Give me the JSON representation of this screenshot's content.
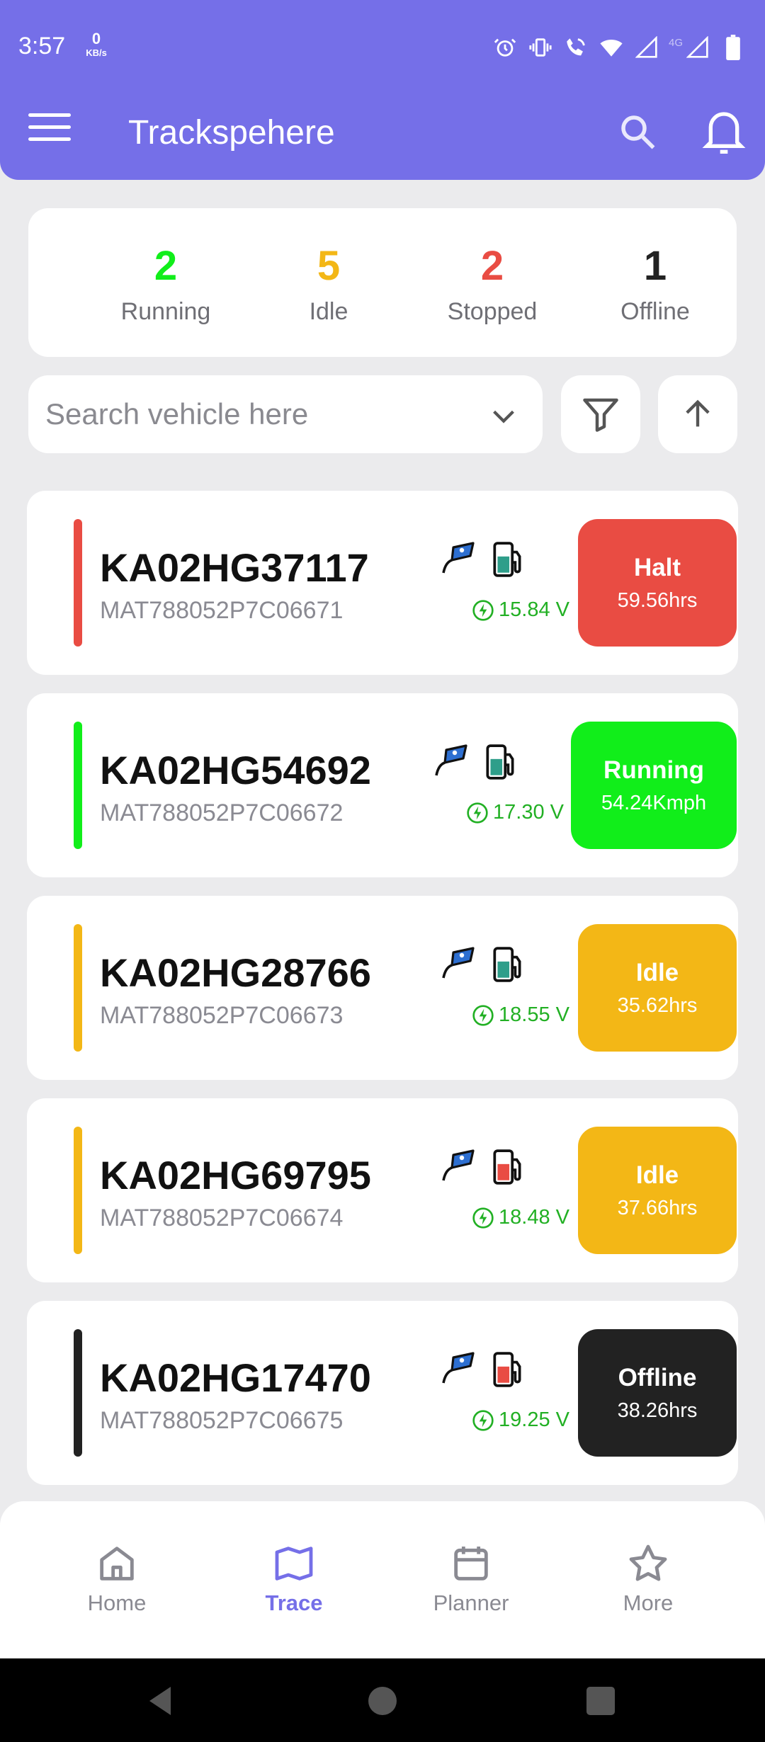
{
  "status_bar": {
    "time": "3:57",
    "kbs_value": "0",
    "kbs_unit": "KB/s",
    "network": "4G"
  },
  "header": {
    "title": "Trackspehere",
    "menu_icon": "hamburger-menu-icon",
    "search_icon": "search-icon",
    "bell_icon": "bell-icon"
  },
  "summary": [
    {
      "count": "2",
      "label": "Running",
      "color": "#11ee1a"
    },
    {
      "count": "5",
      "label": "Idle",
      "color": "#f3b716"
    },
    {
      "count": "2",
      "label": "Stopped",
      "color": "#e94c43"
    },
    {
      "count": "1",
      "label": "Offline",
      "color": "#222222"
    }
  ],
  "search": {
    "placeholder": "Search vehicle here",
    "value": ""
  },
  "vehicles": [
    {
      "plate": "KA02HG37117",
      "vin": "MAT788052P7C06671",
      "voltage": "15.84 V",
      "status": "Halt",
      "detail": "59.56hrs",
      "color": "#e94c43",
      "fuel_color": "#2e9e8a"
    },
    {
      "plate": "KA02HG54692",
      "vin": "MAT788052P7C06672",
      "voltage": "17.30 V",
      "status": "Running",
      "detail": "54.24Kmph",
      "color": "#11ee1a",
      "fuel_color": "#2e9e8a"
    },
    {
      "plate": "KA02HG28766",
      "vin": "MAT788052P7C06673",
      "voltage": "18.55 V",
      "status": "Idle",
      "detail": "35.62hrs",
      "color": "#f3b716",
      "fuel_color": "#2e9e8a"
    },
    {
      "plate": "KA02HG69795",
      "vin": "MAT788052P7C06674",
      "voltage": "18.48 V",
      "status": "Idle",
      "detail": "37.66hrs",
      "color": "#f3b716",
      "fuel_color": "#e94c43"
    },
    {
      "plate": "KA02HG17470",
      "vin": "MAT788052P7C06675",
      "voltage": "19.25 V",
      "status": "Offline",
      "detail": "38.26hrs",
      "color": "#222222",
      "fuel_color": "#e94c43"
    }
  ],
  "bottom_nav": [
    {
      "label": "Home",
      "icon": "home-icon",
      "active": false
    },
    {
      "label": "Trace",
      "icon": "map-icon",
      "active": true
    },
    {
      "label": "Planner",
      "icon": "calendar-icon",
      "active": false
    },
    {
      "label": "More",
      "icon": "star-icon",
      "active": false
    }
  ],
  "colors": {
    "brand": "#756fe8",
    "voltage": "#22b024"
  }
}
